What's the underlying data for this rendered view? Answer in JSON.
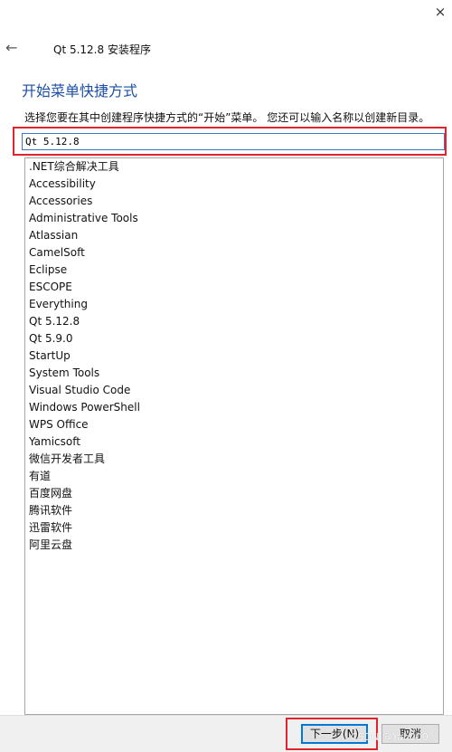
{
  "window": {
    "title": "Qt 5.12.8 安装程序",
    "close_icon": "×",
    "back_icon": "←"
  },
  "page": {
    "heading": "开始菜单快捷方式",
    "description": "选择您要在其中创建程序快捷方式的“开始”菜单。 您还可以输入名称以创建新目录。"
  },
  "folder_input": {
    "value": "Qt 5.12.8"
  },
  "folders": [
    ".NET综合解决工具",
    "Accessibility",
    "Accessories",
    "Administrative Tools",
    "Atlassian",
    "CamelSoft",
    "Eclipse",
    "ESCOPE",
    "Everything",
    "Qt 5.12.8",
    "Qt 5.9.0",
    "StartUp",
    "System Tools",
    "Visual Studio Code",
    "Windows PowerShell",
    "WPS Office",
    "Yamicsoft",
    "微信开发者工具",
    "有道",
    "百度网盘",
    "腾讯软件",
    "迅雷软件",
    "阿里云盘"
  ],
  "footer": {
    "next_label": "下一步(N)",
    "cancel_label": "取消",
    "watermark": "CSDN @Yab000"
  }
}
